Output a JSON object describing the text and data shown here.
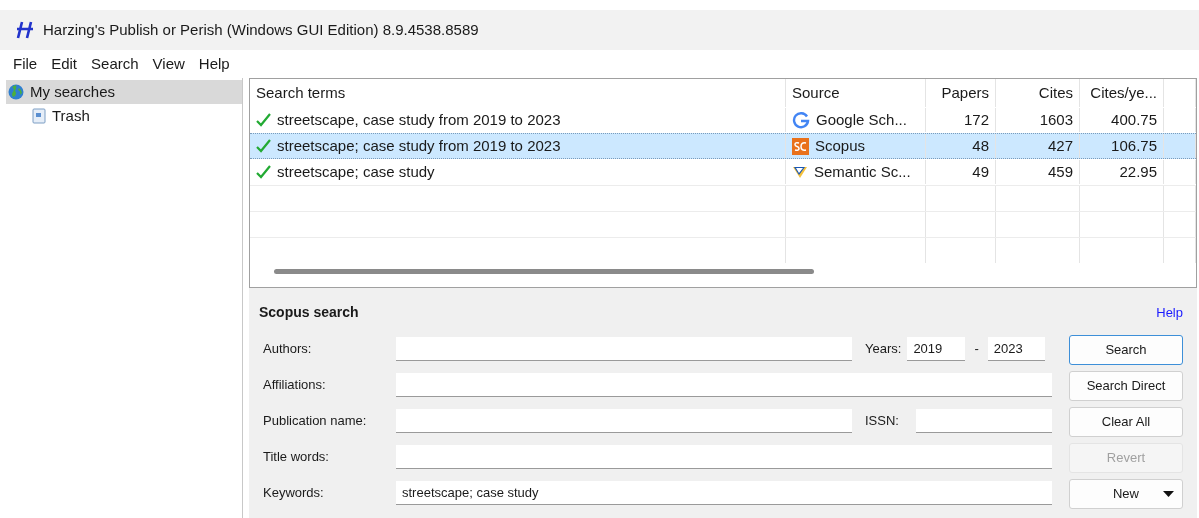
{
  "window": {
    "title": "Harzing's Publish or Perish (Windows GUI Edition) 8.9.4538.8589"
  },
  "menu": [
    "File",
    "Edit",
    "Search",
    "View",
    "Help"
  ],
  "tree": [
    {
      "label": "My searches",
      "kind": "globe",
      "selected": true
    },
    {
      "label": "Trash",
      "kind": "trash",
      "selected": false
    }
  ],
  "results": {
    "columns": [
      "Search terms",
      "Source",
      "Papers",
      "Cites",
      "Cites/ye..."
    ],
    "rows": [
      {
        "terms": "streetscape, case study from 2019 to 2023",
        "source": "Google Sch...",
        "kind": "google",
        "papers": "172",
        "cites": "1603",
        "cites_per_year": "400.75",
        "selected": false
      },
      {
        "terms": "streetscape; case study from 2019 to 2023",
        "source": "Scopus",
        "kind": "scopus",
        "papers": "48",
        "cites": "427",
        "cites_per_year": "106.75",
        "selected": true
      },
      {
        "terms": "streetscape; case study",
        "source": "Semantic Sc...",
        "kind": "semantic",
        "papers": "49",
        "cites": "459",
        "cites_per_year": "22.95",
        "selected": false
      }
    ]
  },
  "form": {
    "title": "Scopus search",
    "help": "Help",
    "fields": [
      {
        "label": "Authors:",
        "extra": {
          "kind": "years",
          "label": "Years:",
          "from": "2019",
          "separator": "-",
          "to": "2023"
        }
      },
      {
        "label": "Affiliations:"
      },
      {
        "label": "Publication name:",
        "extra": {
          "kind": "issn",
          "label": "ISSN:"
        }
      },
      {
        "label": "Title words:"
      },
      {
        "label": "Keywords:",
        "value": "streetscape; case study"
      }
    ],
    "buttons": [
      {
        "label": "Search",
        "disabled": false,
        "default": true
      },
      {
        "label": "Search Direct",
        "disabled": false,
        "default": false
      },
      {
        "label": "Clear All",
        "disabled": false,
        "default": false
      },
      {
        "label": "Revert",
        "disabled": true,
        "default": false
      },
      {
        "label": "New",
        "disabled": false,
        "default": false,
        "dropdown": true
      }
    ]
  }
}
